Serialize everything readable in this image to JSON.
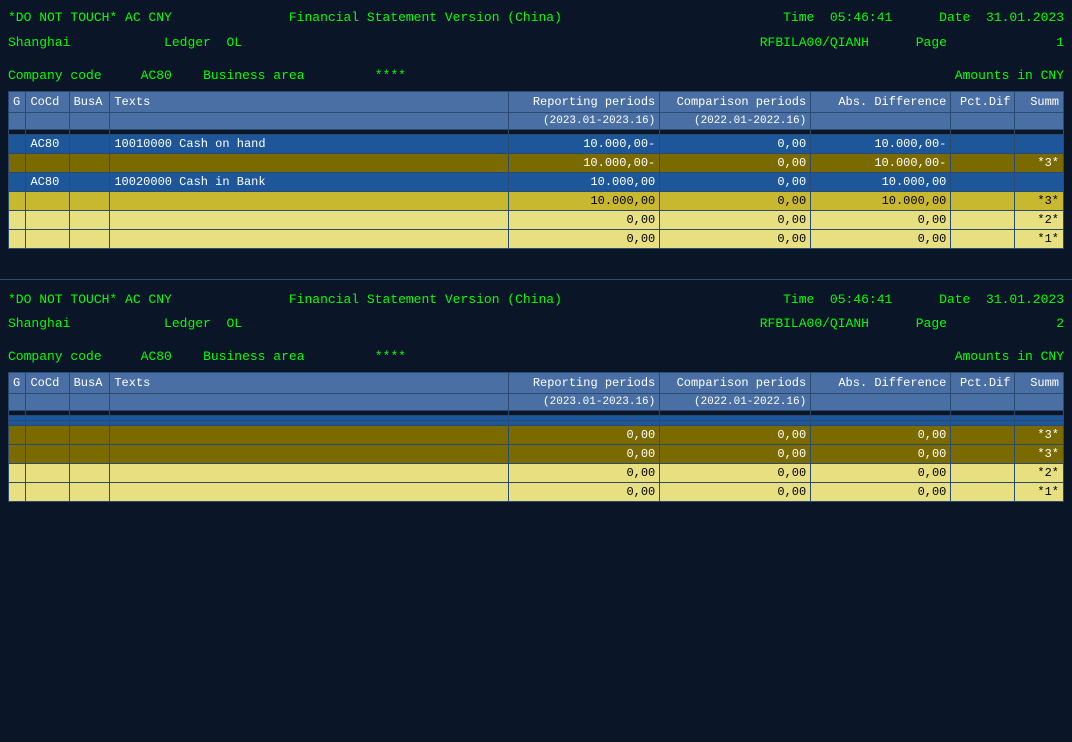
{
  "page1": {
    "header": {
      "title_prefix": "*DO NOT TOUCH* AC CNY",
      "title_center": "Financial Statement Version (China)",
      "time_label": "Time",
      "time_value": "05:46:41",
      "date_label": "Date",
      "date_value": "31.01.2023"
    },
    "meta": {
      "location": "Shanghai",
      "ledger_label": "Ledger",
      "ledger_value": "OL",
      "report_id": "RFBILA00/QIANH",
      "page_label": "Page",
      "page_number": "1"
    },
    "company": {
      "code_label": "Company code",
      "code_value": "AC80",
      "area_label": "Business area",
      "area_value": "****",
      "amounts_label": "Amounts in CNY"
    },
    "table": {
      "headers": {
        "g": "G",
        "cocd": "CoCd",
        "busa": "BusA",
        "texts": "Texts",
        "rep_periods": "Reporting periods",
        "comp_periods": "Comparison periods",
        "abs_diff": "Abs. Difference",
        "pct_dif": "Pct.Dif",
        "summ": "Summ"
      },
      "subheader": {
        "rep_range": "(2023.01-2023.16)",
        "comp_range": "(2022.01-2022.16)"
      },
      "rows": [
        {
          "type": "empty",
          "g": "",
          "cocd": "",
          "busa": "",
          "texts": "",
          "rep": "",
          "comp": "",
          "abs": "",
          "pct": "",
          "sum": ""
        },
        {
          "type": "blue",
          "g": "",
          "cocd": "AC80",
          "busa": "",
          "texts": "10010000    Cash on hand",
          "rep": "10.000,00-",
          "comp": "0,00",
          "abs": "10.000,00-",
          "pct": "",
          "sum": ""
        },
        {
          "type": "gold",
          "g": "",
          "cocd": "",
          "busa": "",
          "texts": "",
          "rep": "10.000,00-",
          "comp": "0,00",
          "abs": "10.000,00-",
          "pct": "",
          "sum": "*3*"
        },
        {
          "type": "blue",
          "g": "",
          "cocd": "AC80",
          "busa": "",
          "texts": "10020000    Cash in Bank",
          "rep": "10.000,00",
          "comp": "0,00",
          "abs": "10.000,00",
          "pct": "",
          "sum": ""
        },
        {
          "type": "light-gold",
          "g": "",
          "cocd": "",
          "busa": "",
          "texts": "",
          "rep": "10.000,00",
          "comp": "0,00",
          "abs": "10.000,00",
          "pct": "",
          "sum": "*3*"
        },
        {
          "type": "light-yellow",
          "g": "",
          "cocd": "",
          "busa": "",
          "texts": "",
          "rep": "0,00",
          "comp": "0,00",
          "abs": "0,00",
          "pct": "",
          "sum": "*2*"
        },
        {
          "type": "light-yellow",
          "g": "",
          "cocd": "",
          "busa": "",
          "texts": "",
          "rep": "0,00",
          "comp": "0,00",
          "abs": "0,00",
          "pct": "",
          "sum": "*1*"
        }
      ]
    }
  },
  "page2": {
    "header": {
      "title_prefix": "*DO NOT TOUCH* AC CNY",
      "title_center": "Financial Statement Version (China)",
      "time_label": "Time",
      "time_value": "05:46:41",
      "date_label": "Date",
      "date_value": "31.01.2023"
    },
    "meta": {
      "location": "Shanghai",
      "ledger_label": "Ledger",
      "ledger_value": "OL",
      "report_id": "RFBILA00/QIANH",
      "page_label": "Page",
      "page_number": "2"
    },
    "company": {
      "code_label": "Company code",
      "code_value": "AC80",
      "area_label": "Business area",
      "area_value": "****",
      "amounts_label": "Amounts in CNY"
    },
    "table": {
      "headers": {
        "g": "G",
        "cocd": "CoCd",
        "busa": "BusA",
        "texts": "Texts",
        "rep_periods": "Reporting periods",
        "comp_periods": "Comparison periods",
        "abs_diff": "Abs. Difference",
        "pct_dif": "Pct.Dif",
        "summ": "Summ"
      },
      "subheader": {
        "rep_range": "(2023.01-2023.16)",
        "comp_range": "(2022.01-2022.16)"
      },
      "rows": [
        {
          "type": "empty",
          "g": "",
          "cocd": "",
          "busa": "",
          "texts": "",
          "rep": "",
          "comp": "",
          "abs": "",
          "pct": "",
          "sum": ""
        },
        {
          "type": "blue",
          "g": "",
          "cocd": "",
          "busa": "",
          "texts": "",
          "rep": "",
          "comp": "",
          "abs": "",
          "pct": "",
          "sum": ""
        },
        {
          "type": "blue",
          "g": "",
          "cocd": "",
          "busa": "",
          "texts": "",
          "rep": "",
          "comp": "",
          "abs": "",
          "pct": "",
          "sum": ""
        },
        {
          "type": "gold",
          "g": "",
          "cocd": "",
          "busa": "",
          "texts": "",
          "rep": "0,00",
          "comp": "0,00",
          "abs": "0,00",
          "pct": "",
          "sum": "*3*"
        },
        {
          "type": "gold",
          "g": "",
          "cocd": "",
          "busa": "",
          "texts": "",
          "rep": "0,00",
          "comp": "0,00",
          "abs": "0,00",
          "pct": "",
          "sum": "*3*"
        },
        {
          "type": "light-yellow",
          "g": "",
          "cocd": "",
          "busa": "",
          "texts": "",
          "rep": "0,00",
          "comp": "0,00",
          "abs": "0,00",
          "pct": "",
          "sum": "*2*"
        },
        {
          "type": "light-yellow",
          "g": "",
          "cocd": "",
          "busa": "",
          "texts": "",
          "rep": "0,00",
          "comp": "0,00",
          "abs": "0,00",
          "pct": "",
          "sum": "*1*"
        }
      ]
    }
  }
}
